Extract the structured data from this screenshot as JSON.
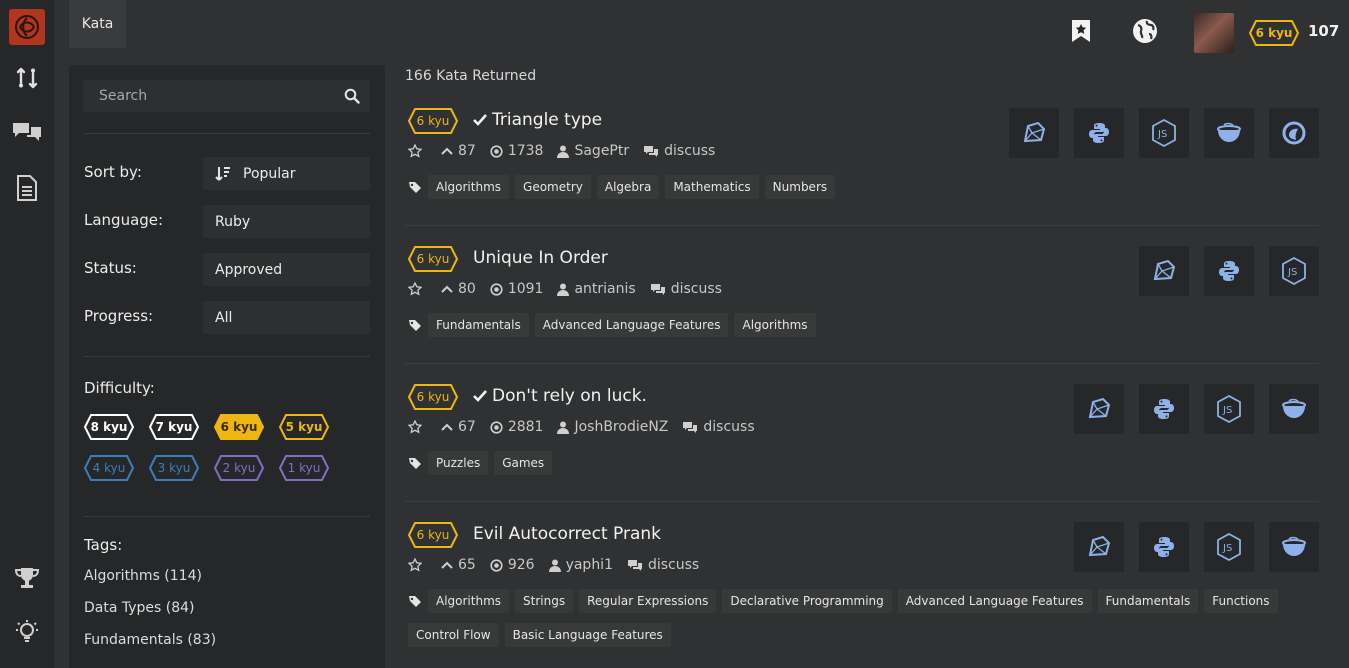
{
  "topbar": {
    "tab_label": "Kata",
    "user_rank": "6 kyu",
    "honor": "107"
  },
  "filters": {
    "search_placeholder": "Search",
    "sort_label": "Sort by:",
    "sort_value": "Popular",
    "language_label": "Language:",
    "language_value": "Ruby",
    "status_label": "Status:",
    "status_value": "Approved",
    "progress_label": "Progress:",
    "progress_value": "All",
    "difficulty_label": "Difficulty:",
    "difficulty": [
      {
        "label": "8 kyu",
        "color": "#ffffff",
        "selected": false
      },
      {
        "label": "7 kyu",
        "color": "#ffffff",
        "selected": false
      },
      {
        "label": "6 kyu",
        "color": "#ecb613",
        "selected": true
      },
      {
        "label": "5 kyu",
        "color": "#ecb613",
        "selected": false
      },
      {
        "label": "4 kyu",
        "color": "#3c7ebb",
        "selected": false
      },
      {
        "label": "3 kyu",
        "color": "#3c7ebb",
        "selected": false
      },
      {
        "label": "2 kyu",
        "color": "#866cc7",
        "selected": false
      },
      {
        "label": "1 kyu",
        "color": "#866cc7",
        "selected": false
      }
    ],
    "tags_label": "Tags:",
    "tags": [
      "Algorithms (114)",
      "Data Types (84)",
      "Fundamentals (83)"
    ]
  },
  "results": {
    "count_text": "166 Kata Returned",
    "items": [
      {
        "rank": "6 kyu",
        "completed": true,
        "title": "Triangle type",
        "votes": "87",
        "completions": "1738",
        "author": "SagePtr",
        "discuss": "discuss",
        "tags": [
          "Algorithms",
          "Geometry",
          "Algebra",
          "Mathematics",
          "Numbers"
        ],
        "languages": [
          "ruby-icon",
          "python-icon",
          "javascript-icon",
          "coffeescript-icon",
          "elixir-icon"
        ]
      },
      {
        "rank": "6 kyu",
        "completed": false,
        "title": "Unique In Order",
        "votes": "80",
        "completions": "1091",
        "author": "antrianis",
        "discuss": "discuss",
        "tags": [
          "Fundamentals",
          "Advanced Language Features",
          "Algorithms"
        ],
        "languages": [
          "ruby-icon",
          "python-icon",
          "javascript-icon"
        ]
      },
      {
        "rank": "6 kyu",
        "completed": true,
        "title": "Don't rely on luck.",
        "votes": "67",
        "completions": "2881",
        "author": "JoshBrodieNZ",
        "discuss": "discuss",
        "tags": [
          "Puzzles",
          "Games"
        ],
        "languages": [
          "ruby-icon",
          "python-icon",
          "javascript-icon",
          "coffeescript-icon"
        ]
      },
      {
        "rank": "6 kyu",
        "completed": false,
        "title": "Evil Autocorrect Prank",
        "votes": "65",
        "completions": "926",
        "author": "yaphi1",
        "discuss": "discuss",
        "tags": [
          "Algorithms",
          "Strings",
          "Regular Expressions",
          "Declarative Programming",
          "Advanced Language Features",
          "Fundamentals",
          "Functions",
          "Control Flow",
          "Basic Language Features"
        ],
        "languages": [
          "ruby-icon",
          "python-icon",
          "javascript-icon",
          "coffeescript-icon"
        ]
      }
    ]
  }
}
